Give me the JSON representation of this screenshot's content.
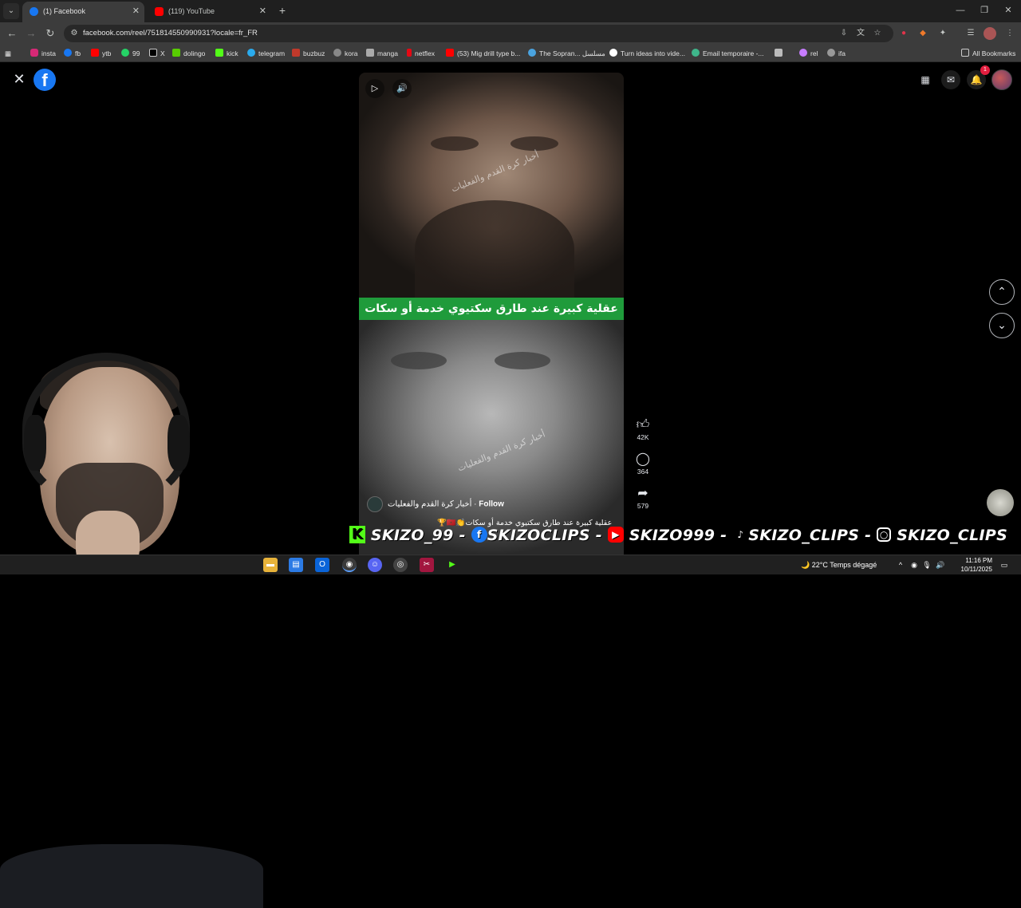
{
  "browser": {
    "tabs": [
      {
        "title": "(1) Facebook",
        "icon": "facebook-icon",
        "color": "#1877f2"
      },
      {
        "title": "(119) YouTube",
        "icon": "youtube-icon",
        "color": "#ff0000"
      }
    ],
    "url": "facebook.com/reel/751814550990931?locale=fr_FR",
    "bookmarks": [
      {
        "label": "insta",
        "color": "#d62976"
      },
      {
        "label": "fb",
        "color": "#1877f2"
      },
      {
        "label": "ytb",
        "color": "#ff0000"
      },
      {
        "label": "99",
        "color": "#25d366"
      },
      {
        "label": "X",
        "color": "#ffffff"
      },
      {
        "label": "dolingo",
        "color": "#58cc02"
      },
      {
        "label": "kick",
        "color": "#53fc18"
      },
      {
        "label": "telegram",
        "color": "#2aabee"
      },
      {
        "label": "buzbuz",
        "color": "#c0392b"
      },
      {
        "label": "kora",
        "color": "#888888"
      },
      {
        "label": "manga",
        "color": "#aaaaaa"
      },
      {
        "label": "netflex",
        "color": "#e50914"
      },
      {
        "label": "(53) Mig drill type b...",
        "color": "#ff0000"
      },
      {
        "label": "The Sopran... مسلسل",
        "color": "#4aa3df"
      },
      {
        "label": "Turn ideas into vide...",
        "color": "#ffffff"
      },
      {
        "label": "Email temporaire -...",
        "color": "#3fb68b"
      },
      {
        "label": "",
        "color": "#bbbbbb"
      },
      {
        "label": "rel",
        "color": "#c77dff"
      },
      {
        "label": "ifa",
        "color": "#999999"
      }
    ],
    "all_bookmarks": "All Bookmarks"
  },
  "reel": {
    "banner_text": "عقلية كبيرة عند طارق سكتيوي خدمة أو سكات🇲🇦🏆",
    "watermark": "أخبار كرة القدم والفعليات",
    "author": "أخبار كرة القدم والفعليات",
    "follow_label": "Follow",
    "caption": "عقلية كبيرة عند طارق سكتيوي خدمة أو سكات👏🇲🇦🏆",
    "likes": "42K",
    "comments": "364",
    "shares": "579"
  },
  "overlay": {
    "kick": "SKIZO_99 -",
    "facebook": "SKIZOCLIPS -",
    "youtube": "SKIZO999 -",
    "tiktok": "SKIZO_CLIPS -",
    "instagram": "SKIZO_CLIPS"
  },
  "taskbar": {
    "temperature": "22°C",
    "weather": "Temps dégagé",
    "time": "11:16 PM",
    "date": "10/11/2025"
  },
  "notifications": "1"
}
